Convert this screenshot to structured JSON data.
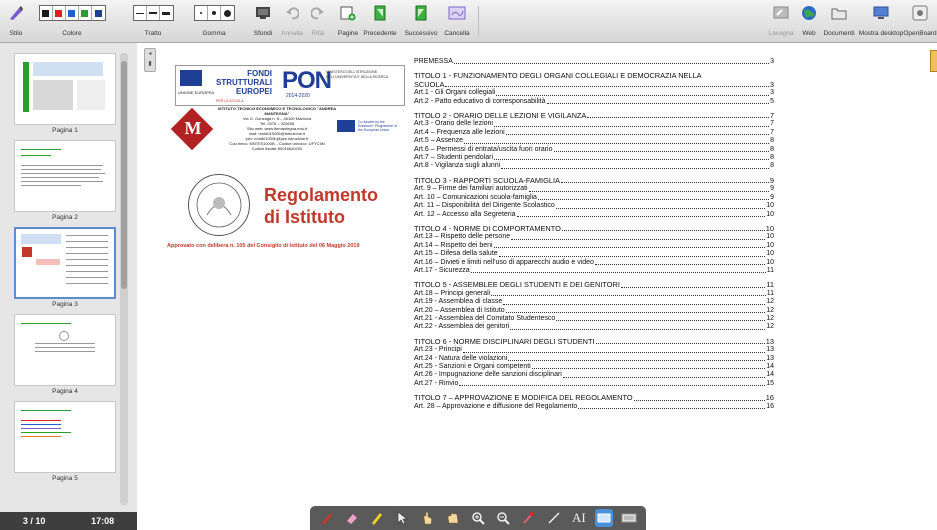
{
  "toolbar": {
    "stile": "Stilo",
    "colore": "Colore",
    "tratto": "Tratto",
    "gomma": "Gomma",
    "sfondi": "Sfondi",
    "annulla": "Annulla",
    "rifai": "Rifai",
    "pagine": "Pagine",
    "precedente": "Precedente",
    "successivo": "Successivo",
    "cancella": "Cancella",
    "lavagna": "Lavagna",
    "web": "Web",
    "documenti": "Documenti",
    "mostra_desktop": "Mostra desktop",
    "openboard": "OpenBoard"
  },
  "colors": {
    "palette": [
      "#1a1a1a",
      "#e02020",
      "#1f5fd1",
      "#2a9d2a",
      "#1f3f96"
    ],
    "accent_red": "#c0392b",
    "pon_blue": "#1f3f96"
  },
  "sidebar": {
    "pages": [
      "Pagina 1",
      "Pagina 2",
      "Pagina 3",
      "Pagina 4",
      "Pagina 5"
    ],
    "selected": "Pagina 3",
    "page_counter": "3 / 10",
    "clock": "17:08"
  },
  "document": {
    "banner_fondi": "FONDI",
    "banner_strutturali": "STRUTTURALI",
    "banner_europei": "EUROPEI",
    "banner_pon": "PON",
    "banner_years": "2014-2020",
    "banner_ue": "UNIONE EUROPEA",
    "school_name": "ISTITUTO TECNICO ECONOMICO E TECNOLOGICO \"ANDREA MANTEGNA\"",
    "school_address": "Via G. Gonzaga n. 8 – 46100 Mantova",
    "school_tel": "Tel. 0376 – 320698",
    "school_web": "Sito web: www.itemantegna.edu.it",
    "school_mail": "mail: mntd01000b@istruzione.it",
    "school_pec": "pec: mntd01000b@pec.istruzione.it",
    "school_code": "Cod.mecc: MNTE01000B – Codice univoco: UFYC5N",
    "school_fiscal": "Codice fiscale 80016640200",
    "erasmus_text": "Co-funded by the Erasmus+ Programme of the European Union",
    "title_line1": "Regolamento",
    "title_line2": "di Istituto",
    "approval": "Approvato con delibera n. 105 del Consiglio di Istituto del 06 Maggio 2019"
  },
  "toc": [
    {
      "t": "PREMESSA",
      "n": "3",
      "head": false
    },
    {
      "gap": true
    },
    {
      "t": "TITOLO 1 - FUNZIONAMENTO DEGLI ORGANI COLLEGIALI E DEMOCRAZIA NELLA",
      "n": "",
      "head": true,
      "nodots": true
    },
    {
      "t": "SCUOLA",
      "n": "3",
      "head": true
    },
    {
      "t": "Art.1 - Gli Organi collegiali",
      "n": "3"
    },
    {
      "t": "Art.2 - Patto educativo di corresponsabilità",
      "n": "5"
    },
    {
      "gap": true
    },
    {
      "t": "TITOLO 2 - ORARIO DELLE LEZIONI E VIGILANZA",
      "n": "7",
      "head": true
    },
    {
      "t": "Art.3 - Orario delle lezioni",
      "n": "7"
    },
    {
      "t": "Art.4 – Frequenza alle lezioni",
      "n": "7"
    },
    {
      "t": "Art.5 – Assenze",
      "n": "8"
    },
    {
      "t": "Art.6 – Permessi di entrata/uscita fuori orario",
      "n": "8"
    },
    {
      "t": "Art.7 – Studenti pendolari",
      "n": "8"
    },
    {
      "t": "Art.8 - Vigilanza sugli alunni",
      "n": "8"
    },
    {
      "gap": true
    },
    {
      "t": "TITOLO 3 - RAPPORTI SCUOLA-FAMIGLIA",
      "n": "9",
      "head": true
    },
    {
      "t": "Art. 9 – Firme dei familiari autorizzati",
      "n": "9"
    },
    {
      "t": "Art. 10 – Comunicazioni scuola-famiglia",
      "n": "9"
    },
    {
      "t": "Art. 11 – Disponibilità del Dirigente Scolastico",
      "n": "10"
    },
    {
      "t": "Art. 12 – Accesso alla Segreteria",
      "n": "10"
    },
    {
      "gap": true
    },
    {
      "t": "TITOLO 4 - NORME DI COMPORTAMENTO",
      "n": "10",
      "head": true
    },
    {
      "t": "Art.13 – Rispetto delle persone",
      "n": "10"
    },
    {
      "t": "Art.14 – Rispetto dei beni",
      "n": "10"
    },
    {
      "t": "Art.15 – Difesa della salute",
      "n": "10"
    },
    {
      "t": "Art.16 – Divieti e limiti nell'uso di apparecchi audio e video",
      "n": "10"
    },
    {
      "t": "Art.17 - Sicurezza",
      "n": "11"
    },
    {
      "gap": true
    },
    {
      "t": "TITOLO 5 - ASSEMBLEE DEGLI STUDENTI E DEI GENITORI",
      "n": "11",
      "head": true
    },
    {
      "t": "Art.18 – Principi generali",
      "n": "11"
    },
    {
      "t": "Art.19 - Assemblea di classe",
      "n": "12"
    },
    {
      "t": "Art.20 – Assemblea di Istituto",
      "n": "12"
    },
    {
      "t": "Art.21 - Assemblea del Comitato Studentesco",
      "n": "12"
    },
    {
      "t": "Art.22 - Assemblea dei genitori",
      "n": "12"
    },
    {
      "gap": true
    },
    {
      "t": "TITOLO 6 - NORME DISCIPLINARI DEGLI STUDENTI",
      "n": "13",
      "head": true
    },
    {
      "t": "Art.23 - Principi",
      "n": "13"
    },
    {
      "t": "Art.24 - Natura delle violazioni",
      "n": "13"
    },
    {
      "t": "Art.25 - Sanzioni e Organi competenti",
      "n": "14"
    },
    {
      "t": "Art.26 - Impugnazione delle sanzioni disciplinari",
      "n": "14"
    },
    {
      "t": "Art.27 - Rinvio",
      "n": "15"
    },
    {
      "gap": true
    },
    {
      "t": "TITOLO 7 – APPROVAZIONE E MODIFICA DEL REGOLAMENTO",
      "n": "16",
      "head": true
    },
    {
      "t": "Art. 28 – Approvazione e diffusione del Regolamento",
      "n": "16"
    }
  ],
  "bottom_tools": [
    "pen-icon",
    "eraser-icon",
    "highlighter-icon",
    "pointer-icon",
    "hand-tap-icon",
    "hand-grab-icon",
    "zoom-in-icon",
    "zoom-out-icon",
    "laser-icon",
    "line-icon",
    "text-icon",
    "capture-icon",
    "keyboard-icon"
  ]
}
